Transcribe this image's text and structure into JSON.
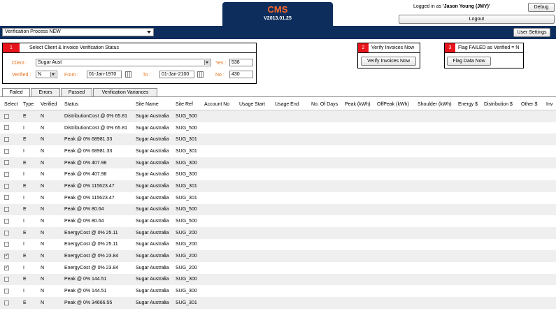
{
  "header": {
    "app_title": "CMS",
    "version": "V2013.01.25",
    "logged_prefix": "Logged in as ",
    "user": "'Jason Young (JMY)'",
    "debug_label": "Debug",
    "logout_label": "Logout"
  },
  "toolbar": {
    "process_selected": "Verification Process NEW",
    "settings_label": "User Settings"
  },
  "panel1": {
    "step": "1",
    "title": "Select Client & Invoice Verification Status",
    "client_label": "Client :",
    "client_value": "Sugar Aust",
    "verified_label": "Verified :",
    "verified_value": "N",
    "from_label": "From :",
    "from_value": "01-Jan-1970",
    "to_label": "To :",
    "to_value": "01-Jan-2100",
    "yes_label": "Yes :",
    "yes_value": "538",
    "no_label": "No :",
    "no_value": "430"
  },
  "panel2": {
    "step": "2",
    "title": "Verify Invoices Now",
    "button": "Verify Invoices Now"
  },
  "panel3": {
    "step": "3",
    "title": "Flag FAILED as Verified = N",
    "button": "Flag Data Now"
  },
  "tabs": [
    {
      "label": "Failed"
    },
    {
      "label": "Errors"
    },
    {
      "label": "Passed"
    },
    {
      "label": "Verification Variances"
    }
  ],
  "table": {
    "columns": [
      "Select",
      "Type",
      "Verified",
      "Status",
      "Site Name",
      "Site Ref",
      "Account No",
      "Usage Start",
      "Usage End",
      "No. Of Days",
      "Peak (kWh)",
      "OffPeak (kWh)",
      "Shoulder (kWh)",
      "Energy $",
      "Distribution $",
      "Other $",
      "Inv"
    ],
    "rows": [
      {
        "checked": false,
        "type": "E",
        "verified": "N",
        "status": "DistributionCost @ 0% 65.81",
        "site": "Sugar Australia",
        "ref": "SUG_500"
      },
      {
        "checked": false,
        "type": "I",
        "verified": "N",
        "status": "DistributionCost @ 0% 65.81",
        "site": "Sugar Australia",
        "ref": "SUG_500"
      },
      {
        "checked": false,
        "type": "E",
        "verified": "N",
        "status": "Peak @ 0% 68981.33",
        "site": "Sugar Australia",
        "ref": "SUG_301"
      },
      {
        "checked": false,
        "type": "I",
        "verified": "N",
        "status": "Peak @ 0% 68981.33",
        "site": "Sugar Australia",
        "ref": "SUG_301"
      },
      {
        "checked": false,
        "type": "E",
        "verified": "N",
        "status": "Peak @ 0% 407.98",
        "site": "Sugar Australia",
        "ref": "SUG_300"
      },
      {
        "checked": false,
        "type": "I",
        "verified": "N",
        "status": "Peak @ 0% 407.98",
        "site": "Sugar Australia",
        "ref": "SUG_300"
      },
      {
        "checked": false,
        "type": "E",
        "verified": "N",
        "status": "Peak @ 0% 115623.47",
        "site": "Sugar Australia",
        "ref": "SUG_301"
      },
      {
        "checked": false,
        "type": "I",
        "verified": "N",
        "status": "Peak @ 0% 115623.47",
        "site": "Sugar Australia",
        "ref": "SUG_301"
      },
      {
        "checked": false,
        "type": "E",
        "verified": "N",
        "status": "Peak @ 0% 80.64",
        "site": "Sugar Australia",
        "ref": "SUG_500"
      },
      {
        "checked": false,
        "type": "I",
        "verified": "N",
        "status": "Peak @ 0% 80.64",
        "site": "Sugar Australia",
        "ref": "SUG_500"
      },
      {
        "checked": false,
        "type": "E",
        "verified": "N",
        "status": "EnergyCost @ 0% 25.11",
        "site": "Sugar Australia",
        "ref": "SUG_200"
      },
      {
        "checked": false,
        "type": "I",
        "verified": "N",
        "status": "EnergyCost @ 0% 25.11",
        "site": "Sugar Australia",
        "ref": "SUG_200"
      },
      {
        "checked": true,
        "type": "E",
        "verified": "N",
        "status": "EnergyCost @ 0% 23.84",
        "site": "Sugar Australia",
        "ref": "SUG_200"
      },
      {
        "checked": true,
        "type": "I",
        "verified": "N",
        "status": "EnergyCost @ 0% 23.84",
        "site": "Sugar Australia",
        "ref": "SUG_200"
      },
      {
        "checked": false,
        "type": "E",
        "verified": "N",
        "status": "Peak @ 0% 144.51",
        "site": "Sugar Australia",
        "ref": "SUG_300"
      },
      {
        "checked": false,
        "type": "I",
        "verified": "N",
        "status": "Peak @ 0% 144.51",
        "site": "Sugar Australia",
        "ref": "SUG_300"
      },
      {
        "checked": false,
        "type": "E",
        "verified": "N",
        "status": "Peak @ 0% 34666.55",
        "site": "Sugar Australia",
        "ref": "SUG_301"
      }
    ]
  }
}
